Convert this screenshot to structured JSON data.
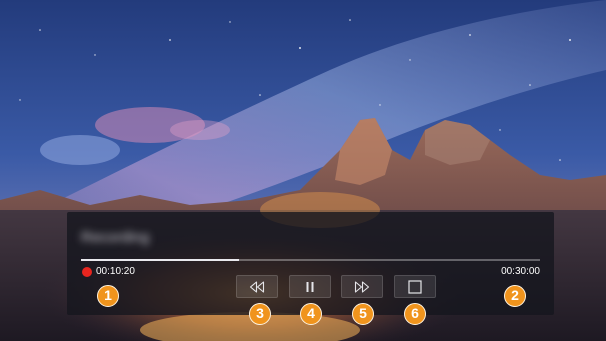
{
  "player": {
    "recording_title": "Recording",
    "current_time": "00:10:20",
    "total_time": "00:30:00",
    "progress": 0.3444,
    "recording_indicator_color": "#e8251f"
  },
  "controls": {
    "rewind_icon": "rewind-icon",
    "pause_icon": "pause-icon",
    "fast_forward_icon": "fast-forward-icon",
    "stop_icon": "stop-icon"
  },
  "callouts": {
    "n1": "1",
    "n2": "2",
    "n3": "3",
    "n4": "4",
    "n5": "5",
    "n6": "6",
    "color": "#f0941d"
  }
}
